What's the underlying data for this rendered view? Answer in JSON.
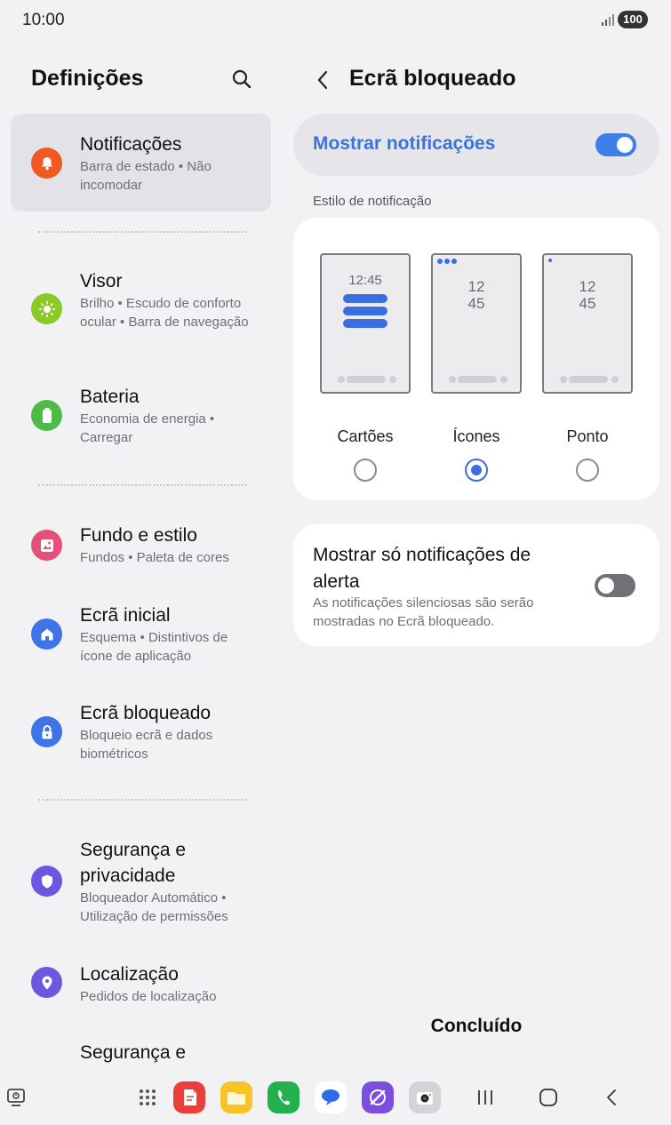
{
  "status_bar": {
    "time": "10:00",
    "battery": "100"
  },
  "left_pane": {
    "title": "Definições",
    "items": [
      {
        "title": "Notificações",
        "subtitle": "Barra de estado  •  Não incomodar",
        "icon": "bell-icon",
        "color": "#ef5a23"
      },
      {
        "title": "Visor",
        "subtitle": "Brilho  •  Escudo de conforto ocular  •  Barra de navegação",
        "icon": "sun-icon",
        "color": "#8ac926"
      },
      {
        "title": "Bateria",
        "subtitle": "Economia de energia  •  Carregar",
        "icon": "battery-icon",
        "color": "#4cbc46"
      },
      {
        "title": "Fundo e estilo",
        "subtitle": "Fundos  •  Paleta de cores",
        "icon": "image-icon",
        "color": "#e5507a"
      },
      {
        "title": "Ecrã inicial",
        "subtitle": "Esquema  •  Distintivos de ícone de aplicação",
        "icon": "home-icon",
        "color": "#3f74e8"
      },
      {
        "title": "Ecrã bloqueado",
        "subtitle": "Bloqueio ecrã e dados biométricos",
        "icon": "lock-icon",
        "color": "#3f74e8"
      },
      {
        "title": "Segurança e privacidade",
        "subtitle": "Bloqueador Automático  •  Utilização de permissões",
        "icon": "shield-icon",
        "color": "#6e56e0"
      },
      {
        "title": "Localização",
        "subtitle": "Pedidos de localização",
        "icon": "location-pin-icon",
        "color": "#6e56e0"
      },
      {
        "title": "Segurança e",
        "subtitle": "",
        "icon": "",
        "color": ""
      }
    ]
  },
  "right_pane": {
    "title": "Ecrã bloqueado",
    "master_toggle": {
      "label": "Mostrar notificações",
      "on": true
    },
    "section_label": "Estilo de notificação",
    "preview_time": "12:45",
    "preview_hours": "12",
    "preview_minutes": "45",
    "styles": [
      {
        "label": "Cartões",
        "selected": false
      },
      {
        "label": "Ícones",
        "selected": true
      },
      {
        "label": "Ponto",
        "selected": false
      }
    ],
    "alert_option": {
      "title": "Mostrar só notificações de alerta",
      "subtitle": "As notificações silenciosas são serão mostradas no Ecrã bloqueado.",
      "on": false
    },
    "done_label": "Concluído"
  },
  "colors": {
    "accent": "#3a6ee0",
    "toggle_on": "#3e7ee8",
    "selected_bg": "#e3e3e7"
  },
  "dock": [
    "app-drawer-icon",
    "notes-app-icon",
    "files-app-icon",
    "phone-app-icon",
    "messages-app-icon",
    "browser-app-icon",
    "camera-app-icon"
  ]
}
